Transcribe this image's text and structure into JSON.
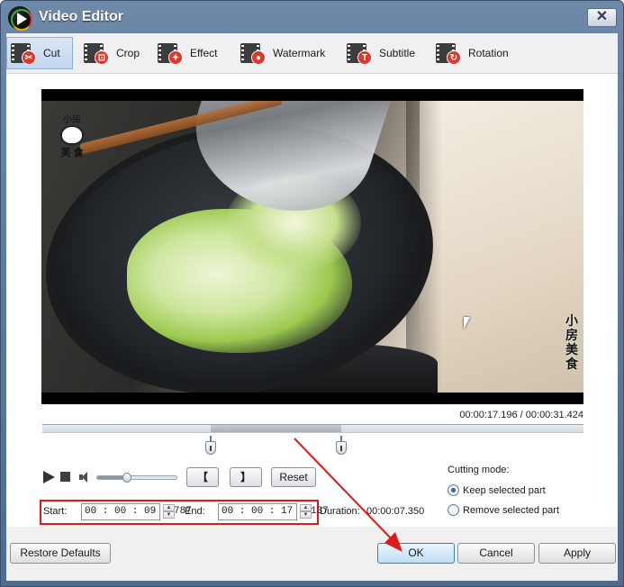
{
  "window": {
    "title": "Video Editor",
    "close_label": "✕"
  },
  "tabs": [
    {
      "label": "Cut",
      "icon": "scissors-icon",
      "glyph": "✂"
    },
    {
      "label": "Crop",
      "icon": "crop-icon",
      "glyph": "⊡"
    },
    {
      "label": "Effect",
      "icon": "effect-wand-icon",
      "glyph": "✦"
    },
    {
      "label": "Watermark",
      "icon": "droplet-icon",
      "glyph": "●"
    },
    {
      "label": "Subtitle",
      "icon": "text-t-icon",
      "glyph": "T"
    },
    {
      "label": "Rotation",
      "icon": "rotate-icon",
      "glyph": "↻"
    }
  ],
  "video": {
    "logo_text": "芙 食",
    "logo_top": "小房",
    "side_text": "小房美食",
    "position_time": "00:00:17.196 / 00:00:31.424"
  },
  "timeline": {
    "selection_start_fraction": 0.311,
    "selection_end_fraction": 0.553
  },
  "controls": {
    "volume_level": 0.38,
    "mark_in_label": "【",
    "mark_out_label": "】",
    "reset_label": "Reset",
    "start_label": "Start:",
    "start_value": "00 : 00 : 09 . 787",
    "end_label": "End:",
    "end_value": "00 : 00 : 17 . 137",
    "duration_label": "Duration:",
    "duration_value": "00:00:07.350"
  },
  "cutting_mode": {
    "title": "Cutting mode:",
    "options": [
      {
        "label": "Keep selected part",
        "selected": true
      },
      {
        "label": "Remove selected part",
        "selected": false
      }
    ]
  },
  "footer": {
    "restore_label": "Restore Defaults",
    "ok_label": "OK",
    "cancel_label": "Cancel",
    "apply_label": "Apply"
  },
  "colors": {
    "highlight": "#e01919",
    "title_bar": "#5d789b",
    "accent": "#2b63b8"
  }
}
